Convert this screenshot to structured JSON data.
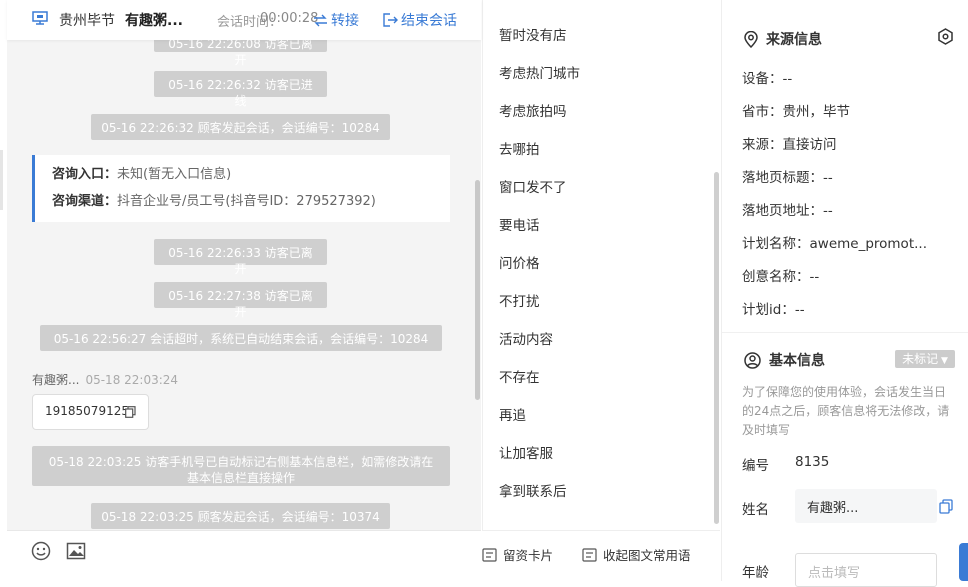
{
  "header": {
    "location": "贵州毕节",
    "visitor_name": "有趣粥...",
    "time_label": "会话时间：",
    "time_value": "00:00:28",
    "transfer_label": "转接",
    "end_label": "结束会话"
  },
  "chat": {
    "clipped_msg": "05-16 22:26:08 访客已离开",
    "sys1": "05-16 22:26:32 访客已进线",
    "sys2": "05-16 22:26:32 顾客发起会话，会话编号：10284",
    "info": {
      "entry_label": "咨询入口：",
      "entry_value": "未知(暂无入口信息)",
      "channel_label": "咨询渠道：",
      "channel_value": "抖音企业号/员工号(抖音号ID：279527392)"
    },
    "sys3": "05-16 22:26:33 访客已离开",
    "sys4": "05-16 22:27:38 访客已离开",
    "sys5": "05-16 22:56:27 会话超时，系统已自动结束会话，会话编号：10284",
    "sender_name": "有趣粥...",
    "sender_time": "05-18 22:03:24",
    "phone": "19185079125",
    "sys6": "05-18 22:03:25 访客手机号已自动标记右侧基本信息栏，如需修改请在基本信息栏直接操作",
    "sys7": "05-18 22:03:25 顾客发起会话，会话编号：10374"
  },
  "phrases": {
    "items": [
      "暂时没有店",
      "考虑热门城市",
      "考虑旅拍吗",
      "去哪拍",
      "窗口发不了",
      "要电话",
      "问价格",
      "不打扰",
      "活动内容",
      "不存在",
      "再追",
      "让加客服",
      "拿到联系后"
    ],
    "leave_card": "留资卡片",
    "collapse": "收起图文常用语"
  },
  "source": {
    "title": "来源信息",
    "rows": [
      {
        "label": "设备：",
        "value": "--"
      },
      {
        "label": "省市：",
        "value": "贵州，毕节"
      },
      {
        "label": "来源：",
        "value": "直接访问"
      },
      {
        "label": "落地页标题：",
        "value": "--"
      },
      {
        "label": "落地页地址：",
        "value": "--"
      },
      {
        "label": "计划名称：",
        "value": "aweme_promot..."
      },
      {
        "label": "创意名称：",
        "value": "--"
      },
      {
        "label": "计划id：",
        "value": "--"
      }
    ]
  },
  "basic": {
    "title": "基本信息",
    "tag": "未标记",
    "notice": "为了保障您的使用体验，会话发生当日的24点之后，顾客信息将无法修改，请及时填写",
    "id_label": "编号",
    "id_value": "8135",
    "name_label": "姓名",
    "name_value": "有趣粥...",
    "age_label": "年龄",
    "age_placeholder": "点击填写"
  },
  "colors": {
    "accent": "#3a7bd5",
    "system_bubble": "#cfcfcf"
  }
}
